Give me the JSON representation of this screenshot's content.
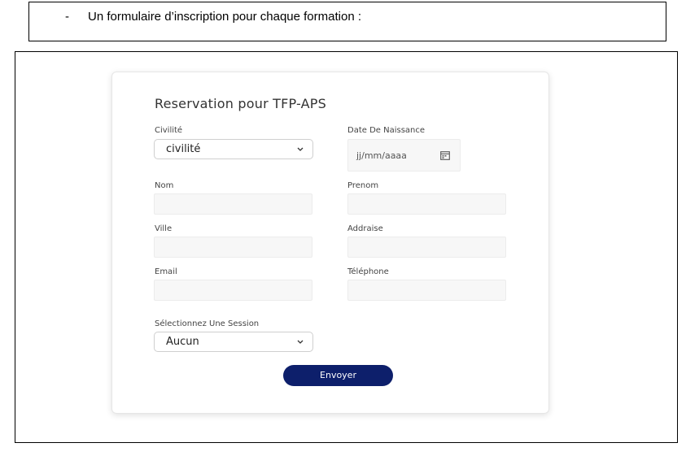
{
  "caption": {
    "dash": "-",
    "text": "Un formulaire d’inscription pour chaque formation :"
  },
  "form": {
    "title": "Reservation pour TFP-APS",
    "civilite": {
      "label": "Civilité",
      "value": "civilité"
    },
    "date_naissance": {
      "label": "Date De Naissance",
      "placeholder": "jj/mm/aaaa"
    },
    "nom": {
      "label": "Nom",
      "value": ""
    },
    "prenom": {
      "label": "Prenom",
      "value": ""
    },
    "ville": {
      "label": "Ville",
      "value": ""
    },
    "addraise": {
      "label": "Addraise",
      "value": ""
    },
    "email": {
      "label": "Email",
      "value": ""
    },
    "telephone": {
      "label": "Téléphone",
      "value": ""
    },
    "session": {
      "label": "Sélectionnez Une Session",
      "value": "Aucun"
    },
    "submit_label": "Envoyer"
  },
  "icons": {
    "select_chevron": "chevron-down-icon",
    "date_picker": "calendar-icon"
  },
  "colors": {
    "submit_button": "#0d1f6b",
    "input_background": "#f7f7f7"
  }
}
